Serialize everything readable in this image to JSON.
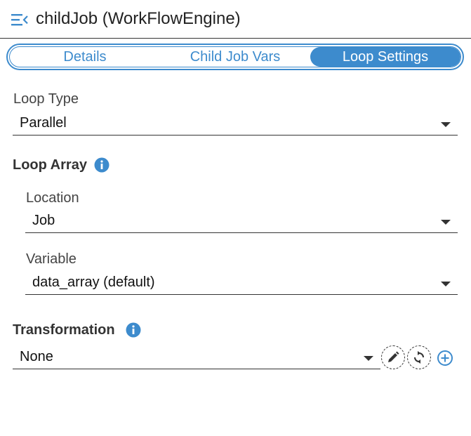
{
  "header": {
    "title": "childJob (WorkFlowEngine)",
    "menu_icon": "menu-collapse-icon"
  },
  "tabs": [
    {
      "label": "Details",
      "active": false
    },
    {
      "label": "Child Job Vars",
      "active": false
    },
    {
      "label": "Loop Settings",
      "active": true
    }
  ],
  "form": {
    "loop_type": {
      "label": "Loop Type",
      "value": "Parallel"
    },
    "loop_array": {
      "title": "Loop Array",
      "info_icon": "info-icon",
      "location": {
        "label": "Location",
        "value": "Job"
      },
      "variable": {
        "label": "Variable",
        "value": "data_array (default)"
      }
    },
    "transformation": {
      "title": "Transformation",
      "info_icon": "info-icon",
      "value": "None",
      "actions": [
        "edit-icon",
        "refresh-icon",
        "add-circle-icon"
      ]
    }
  },
  "colors": {
    "accent": "#3d8bcd",
    "text": "#222222",
    "divider": "#333333"
  }
}
